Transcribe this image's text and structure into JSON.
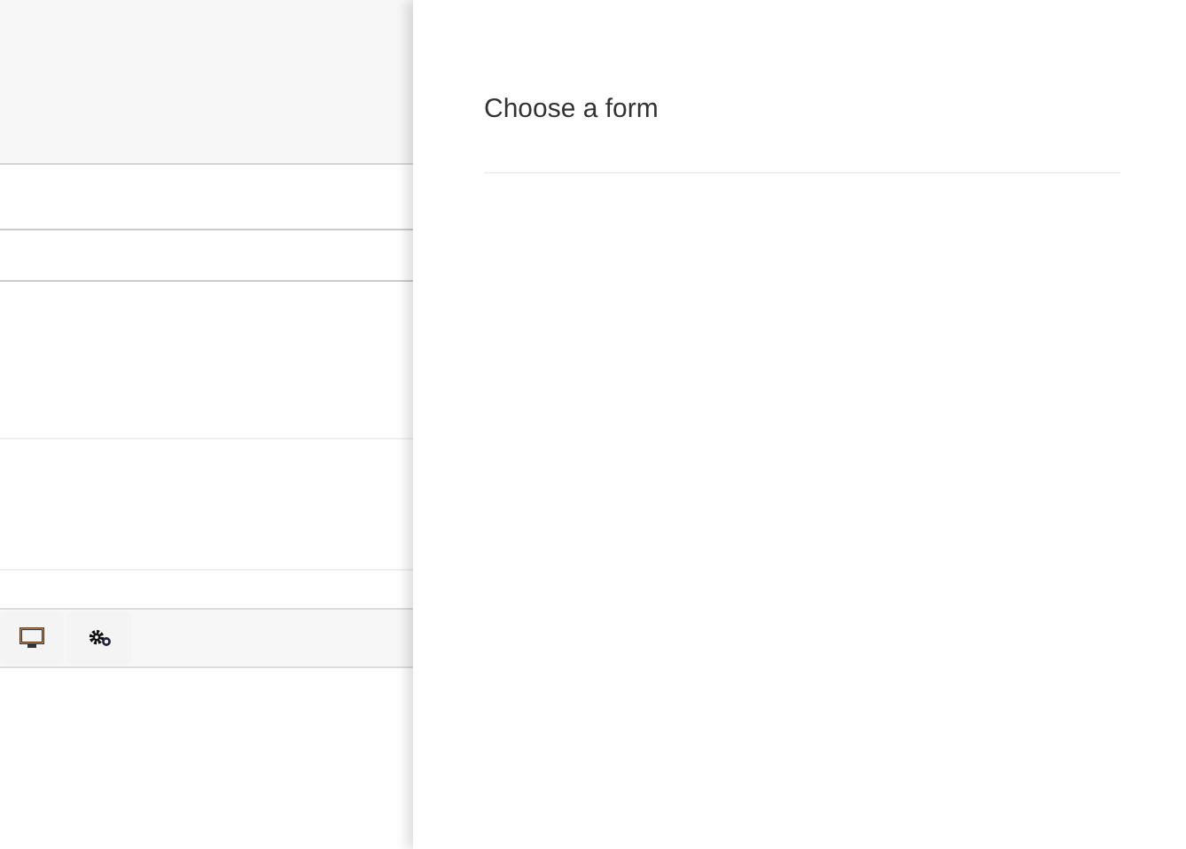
{
  "panel": {
    "title": "Choose a form"
  },
  "toolbar": {
    "buttons": [
      {
        "kind": "monitor"
      },
      {
        "kind": "gears"
      }
    ]
  }
}
